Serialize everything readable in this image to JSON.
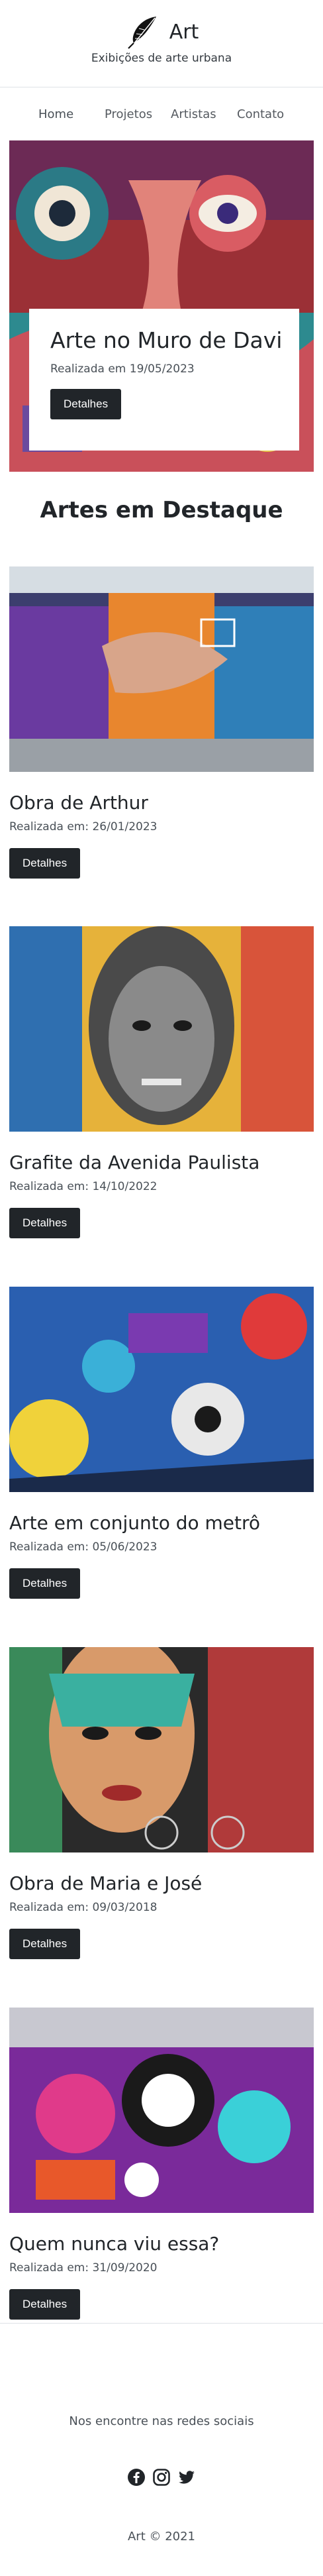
{
  "header": {
    "brand": "Art",
    "tagline": "Exibições de arte urbana",
    "logo_icon": "feather-quill-icon"
  },
  "nav": {
    "items": [
      {
        "label": "Home"
      },
      {
        "label": "Projetos"
      },
      {
        "label": "Artistas"
      },
      {
        "label": "Contato"
      }
    ]
  },
  "hero": {
    "title": "Arte no Muro de Davi",
    "date": "Realizada em 19/05/2023",
    "button": "Detalhes"
  },
  "featured": {
    "title": "Artes em Destaque",
    "items": [
      {
        "title": "Obra de Arthur",
        "date": "Realizada em: 26/01/2023",
        "button": "Detalhes"
      },
      {
        "title": "Grafite da Avenida Paulista",
        "date": "Realizada em: 14/10/2022",
        "button": "Detalhes"
      },
      {
        "title": "Arte em conjunto do metrô",
        "date": "Realizada em: 05/06/2023",
        "button": "Detalhes"
      },
      {
        "title": "Obra de Maria e José",
        "date": "Realizada em: 09/03/2018",
        "button": "Detalhes"
      },
      {
        "title": "Quem nunca viu essa?",
        "date": "Realizada em: 31/09/2020",
        "button": "Detalhes"
      }
    ]
  },
  "footer": {
    "social_text": "Nos encontre nas redes sociais",
    "icons": [
      "facebook-icon",
      "instagram-icon",
      "twitter-icon"
    ],
    "copyright": "Art © 2021"
  },
  "colors": {
    "button_bg": "#212529",
    "text": "#212529",
    "muted": "#495057"
  }
}
